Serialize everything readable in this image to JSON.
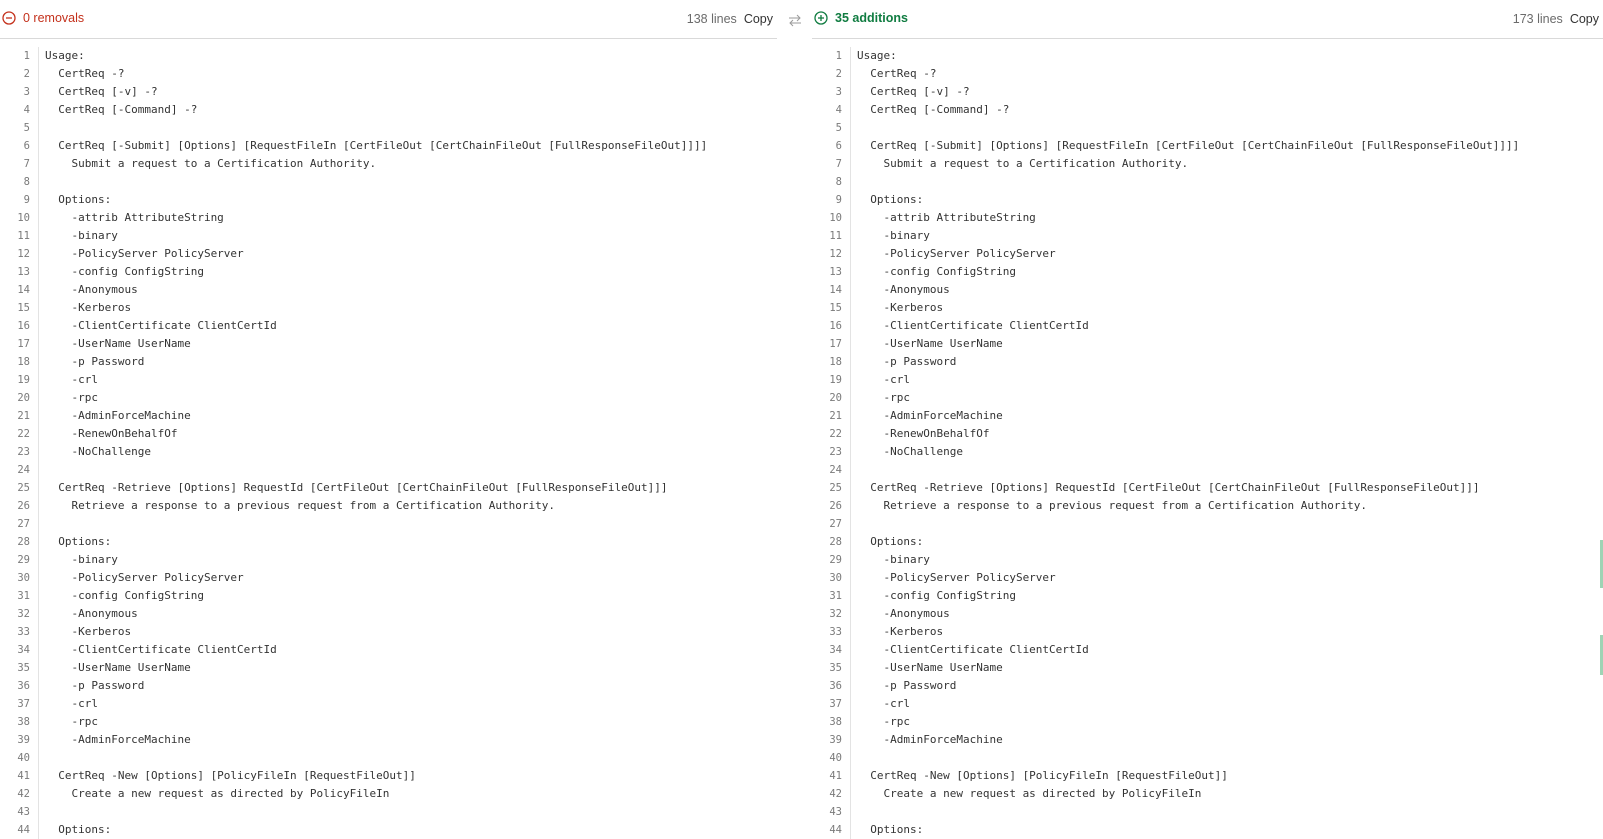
{
  "left": {
    "status_label": "0 removals",
    "line_count": "138 lines",
    "copy_label": "Copy"
  },
  "right": {
    "status_label": "35 additions",
    "line_count": "173 lines",
    "copy_label": "Copy"
  },
  "colors": {
    "removal": "#c4311c",
    "addition": "#107c41"
  },
  "lines": [
    "Usage:",
    "  CertReq -?",
    "  CertReq [-v] -?",
    "  CertReq [-Command] -?",
    "",
    "  CertReq [-Submit] [Options] [RequestFileIn [CertFileOut [CertChainFileOut [FullResponseFileOut]]]]",
    "    Submit a request to a Certification Authority.",
    "",
    "  Options:",
    "    -attrib AttributeString",
    "    -binary",
    "    -PolicyServer PolicyServer",
    "    -config ConfigString",
    "    -Anonymous",
    "    -Kerberos",
    "    -ClientCertificate ClientCertId",
    "    -UserName UserName",
    "    -p Password",
    "    -crl",
    "    -rpc",
    "    -AdminForceMachine",
    "    -RenewOnBehalfOf",
    "    -NoChallenge",
    "",
    "  CertReq -Retrieve [Options] RequestId [CertFileOut [CertChainFileOut [FullResponseFileOut]]]",
    "    Retrieve a response to a previous request from a Certification Authority.",
    "",
    "  Options:",
    "    -binary",
    "    -PolicyServer PolicyServer",
    "    -config ConfigString",
    "    -Anonymous",
    "    -Kerberos",
    "    -ClientCertificate ClientCertId",
    "    -UserName UserName",
    "    -p Password",
    "    -crl",
    "    -rpc",
    "    -AdminForceMachine",
    "",
    "  CertReq -New [Options] [PolicyFileIn [RequestFileOut]]",
    "    Create a new request as directed by PolicyFileIn",
    "",
    "  Options:"
  ]
}
